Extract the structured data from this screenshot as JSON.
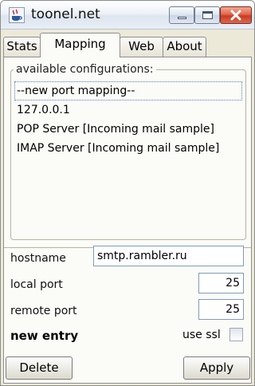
{
  "window": {
    "title": "toonel.net"
  },
  "tabs": [
    {
      "label": "Stats"
    },
    {
      "label": "Mapping"
    },
    {
      "label": "Web"
    },
    {
      "label": "About"
    }
  ],
  "active_tab": "Mapping",
  "configurations": {
    "legend": "available configurations:",
    "items": [
      {
        "label": "--new port mapping--",
        "selected": true
      },
      {
        "label": "127.0.0.1",
        "selected": false
      },
      {
        "label": "POP  Server [Incoming mail sample]",
        "selected": false
      },
      {
        "label": "IMAP Server [Incoming mail sample]",
        "selected": false
      }
    ]
  },
  "form": {
    "hostname_label": "hostname",
    "hostname_value": "smtp.rambler.ru",
    "local_port_label": "local port",
    "local_port_value": "25",
    "remote_port_label": "remote port",
    "remote_port_value": "25",
    "entry_status": "new entry",
    "use_ssl_label": "use ssl",
    "use_ssl_checked": false
  },
  "buttons": {
    "delete_label": "Delete",
    "apply_label": "Apply"
  },
  "icons": {
    "app": "java-coffee-cup-icon",
    "minimize": "minimize-icon",
    "maximize": "maximize-icon",
    "close": "close-icon"
  },
  "colors": {
    "selection_outline": "#5b7fb7",
    "close_button": "#d24a30",
    "window_background": "#ece9d8"
  }
}
